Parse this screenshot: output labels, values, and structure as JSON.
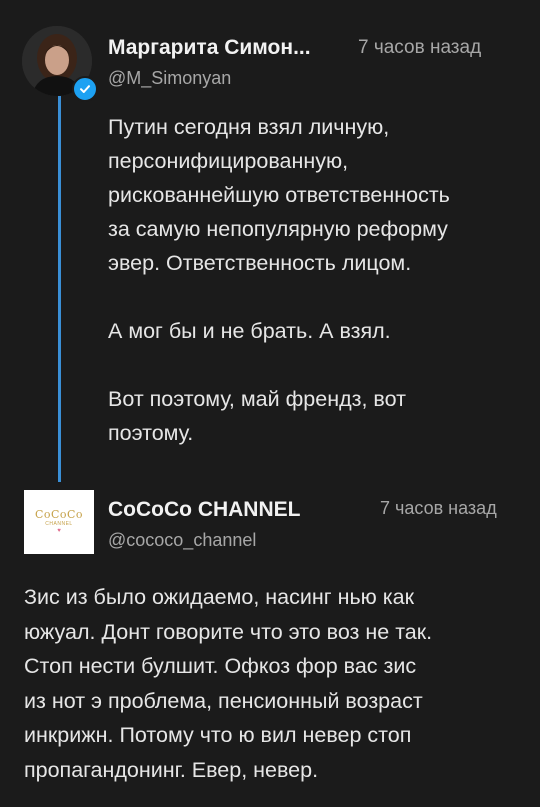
{
  "post1": {
    "author_name": "Маргарита Симон...",
    "handle": "@M_Simonyan",
    "time": "7 часов назад",
    "paragraphs": [
      "Путин сегодня взял личную,\nперсонифицированную,\nрискованнейшую ответственность\nза самую непопулярную реформу\nэвер. Ответственность лицом.",
      "А мог бы и не брать. А взял.",
      "Вот поэтому, май френдз, вот\nпоэтому."
    ]
  },
  "post2": {
    "author_name": "CoCoCo CHANNEL",
    "handle": "@cococo_channel",
    "time": "7 часов назад",
    "avatar_logo_text": "CoCoCo",
    "avatar_logo_subtext": "CHANNEL",
    "text": "Зис из было ожидаемо, насинг нью как\nюжуал. Донт говорите что это воз не так.\nСтоп нести булшит. Офкоз фор вас зис\nиз нот э проблема, пенсионный возраст\nинкрижн. Потому что ю вил невер стоп\nпропагандонинг. Евер, невер."
  },
  "colors": {
    "background": "#1b1b1b",
    "thread_line": "#3a8fd6",
    "verified_badge": "#1da1f2",
    "text_primary": "#e6e6e6",
    "text_secondary": "#a7a7a7",
    "logo_gold": "#c6a24a"
  },
  "icons": {
    "verified": "verified-check-icon",
    "avatar1": "profile-photo-avatar",
    "avatar2": "cococo-logo-avatar"
  }
}
